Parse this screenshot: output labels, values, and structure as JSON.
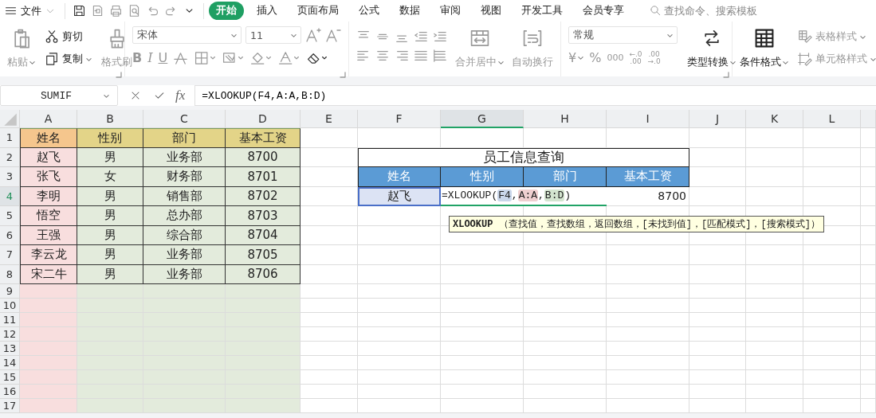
{
  "menu_bar": {
    "file": "文件",
    "tabs": [
      {
        "label": "开始",
        "selected": true
      },
      {
        "label": "插入",
        "selected": false
      },
      {
        "label": "页面布局",
        "selected": false
      },
      {
        "label": "公式",
        "selected": false
      },
      {
        "label": "数据",
        "selected": false
      },
      {
        "label": "审阅",
        "selected": false
      },
      {
        "label": "视图",
        "selected": false
      },
      {
        "label": "开发工具",
        "selected": false
      },
      {
        "label": "会员专享",
        "selected": false
      }
    ],
    "search": {
      "placeholder": "查找命令、搜索模板"
    }
  },
  "ribbon": {
    "paste": {
      "label": "粘贴",
      "disabled": true
    },
    "cut": {
      "label": "剪切",
      "disabled": false
    },
    "copy": {
      "label": "复制",
      "disabled": false
    },
    "format_painter": {
      "label": "格式刷",
      "disabled": true
    },
    "font_name": "宋体",
    "font_size": "11",
    "bold": "B",
    "italic": "I",
    "underline": "U",
    "merge_center": {
      "label": "合并居中",
      "disabled": true
    },
    "wrap_text": {
      "label": "自动换行",
      "disabled": true
    },
    "number_format": "常规",
    "currency": "¥",
    "percent": "%",
    "thousands": "000",
    "increase_decimal": [
      "←.0",
      ".00"
    ],
    "decrease_decimal": [
      ".00",
      "→.0"
    ],
    "type_convert": {
      "label": "类型转换",
      "disabled": false
    },
    "conditional_format": {
      "label": "条件格式",
      "disabled": false
    },
    "table_style": {
      "label": "表格样式",
      "disabled": true
    },
    "cell_style": {
      "label": "单元格样式",
      "disabled": true
    }
  },
  "formula_bar": {
    "name_box": "SUMIF",
    "function_label": "fx",
    "formula": "=XLOOKUP(F4,A:A,B:D)"
  },
  "sheet": {
    "columns": [
      {
        "label": "A",
        "selected": false
      },
      {
        "label": "B",
        "selected": false
      },
      {
        "label": "C",
        "selected": false
      },
      {
        "label": "D",
        "selected": false
      },
      {
        "label": "E",
        "selected": false
      },
      {
        "label": "F",
        "selected": false
      },
      {
        "label": "G",
        "selected": true
      },
      {
        "label": "H",
        "selected": false
      },
      {
        "label": "I",
        "selected": false
      },
      {
        "label": "J",
        "selected": false
      },
      {
        "label": "K",
        "selected": false
      },
      {
        "label": "L",
        "selected": false
      }
    ],
    "rows": [
      {
        "label": "1",
        "selected": false
      },
      {
        "label": "2",
        "selected": false
      },
      {
        "label": "3",
        "selected": false
      },
      {
        "label": "4",
        "selected": true
      },
      {
        "label": "5",
        "selected": false
      },
      {
        "label": "6",
        "selected": false
      },
      {
        "label": "7",
        "selected": false
      },
      {
        "label": "8",
        "selected": false
      },
      {
        "label": "9",
        "selected": false
      },
      {
        "label": "10",
        "selected": false
      },
      {
        "label": "11",
        "selected": false
      },
      {
        "label": "12",
        "selected": false
      },
      {
        "label": "13",
        "selected": false
      },
      {
        "label": "14",
        "selected": false
      },
      {
        "label": "15",
        "selected": false
      },
      {
        "label": "16",
        "selected": false
      },
      {
        "label": "17",
        "selected": false
      }
    ],
    "employee_table": {
      "header": [
        "姓名",
        "性别",
        "部门",
        "基本工资"
      ],
      "rows": [
        [
          "赵飞",
          "男",
          "业务部",
          "8700"
        ],
        [
          "张飞",
          "女",
          "财务部",
          "8701"
        ],
        [
          "李明",
          "男",
          "销售部",
          "8702"
        ],
        [
          "悟空",
          "男",
          "总办部",
          "8703"
        ],
        [
          "王强",
          "男",
          "综合部",
          "8704"
        ],
        [
          "李云龙",
          "男",
          "业务部",
          "8705"
        ],
        [
          "宋二牛",
          "男",
          "业务部",
          "8706"
        ]
      ]
    },
    "lookup_table": {
      "title": "员工信息查询",
      "header": [
        "姓名",
        "性别",
        "部门",
        "基本工资"
      ],
      "name": {
        "text": "赵飞",
        "selected": true
      },
      "formula": [
        {
          "text": "=XLOOKUP(",
          "kind": "plain"
        },
        {
          "text": "F4",
          "kind": "reference",
          "color": "#c9d6ea"
        },
        {
          "text": ",",
          "kind": "plain"
        },
        {
          "text": "A:A",
          "kind": "reference",
          "color": "#efcfd0"
        },
        {
          "text": ",",
          "kind": "plain"
        },
        {
          "text": "B:D",
          "kind": "reference",
          "color": "#d3e4cf"
        },
        {
          "text": ")",
          "kind": "plain"
        }
      ],
      "result": "8700"
    },
    "tooltip": "**XLOOKUP** （查找值，查找数组，返回数组，[未找到值]，[匹配模式]，[搜索模式]）"
  }
}
